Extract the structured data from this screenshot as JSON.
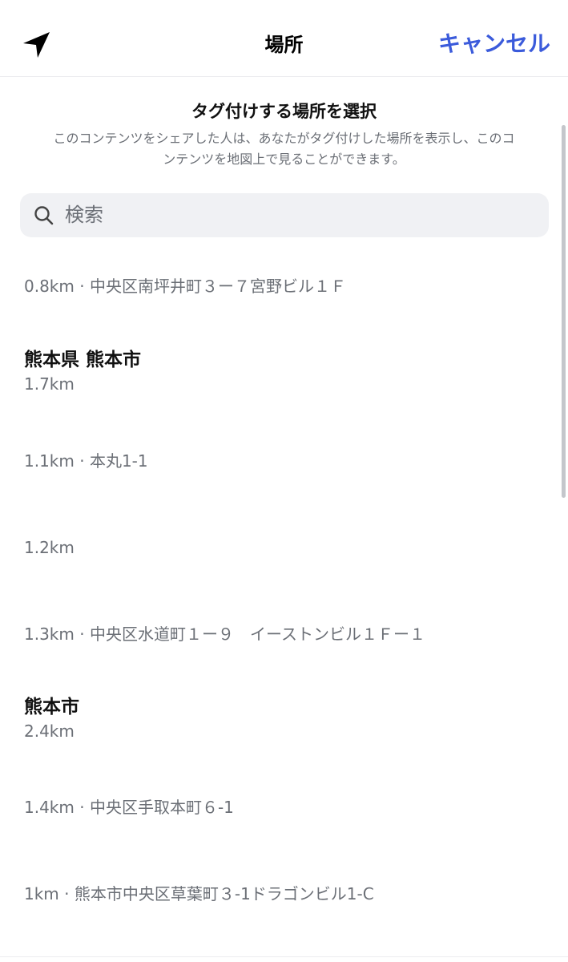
{
  "header": {
    "title": "場所",
    "cancel_label": "キャンセル",
    "location_icon": "navigation-arrow-icon"
  },
  "intro": {
    "title": "タグ付けする場所を選択",
    "description": "このコンテンツをシェアした人は、あなたがタグ付けした場所を表示し、このコンテンツを地図上で見ることができます。"
  },
  "search": {
    "placeholder": "検索",
    "value": ""
  },
  "places": [
    {
      "name": "",
      "detail": "0.8km · 中央区南坪井町３ー７宮野ビル１Ｆ"
    },
    {
      "name": "熊本県 熊本市",
      "detail": "1.7km"
    },
    {
      "name": "",
      "detail": "1.1km · 本丸1-1"
    },
    {
      "name": "",
      "detail": "1.2km"
    },
    {
      "name": "",
      "detail": "1.3km · 中央区水道町１ー９　イーストンビル１Ｆー１"
    },
    {
      "name": "熊本市",
      "detail": "2.4km"
    },
    {
      "name": "",
      "detail": "1.4km · 中央区手取本町６-1"
    },
    {
      "name": "",
      "detail": "1km · 熊本市中央区草葉町３-1ドラゴンビル1-C"
    }
  ]
}
